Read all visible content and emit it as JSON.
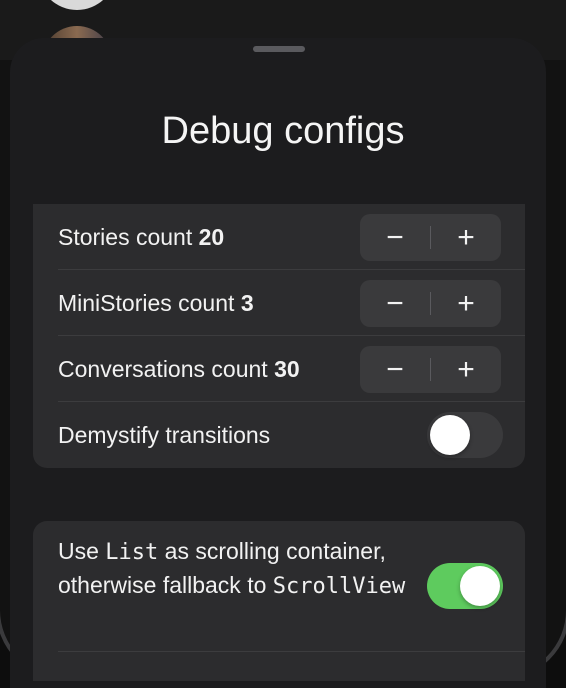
{
  "sheet": {
    "title": "Debug configs"
  },
  "settings": {
    "rows": [
      {
        "label": "Stories count ",
        "value": "20"
      },
      {
        "label": "MiniStories count ",
        "value": "3"
      },
      {
        "label": "Conversations count ",
        "value": "30"
      }
    ],
    "stepper": {
      "minus": "−",
      "plus": "+"
    },
    "demystify": {
      "label": "Demystify transitions",
      "enabled": false
    },
    "use_list": {
      "text_1": "Use ",
      "code_1": "List",
      "text_2": " as scrolling container, otherwise fallback to ",
      "code_2": "ScrollView",
      "enabled": true
    }
  },
  "colors": {
    "toggle_on": "#5ecb5e",
    "sheet_bg": "#1c1c1e",
    "group_bg": "#2c2c2e"
  }
}
